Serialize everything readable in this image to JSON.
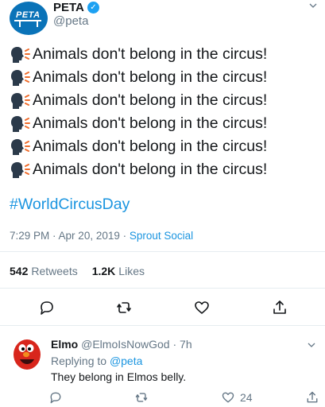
{
  "tweet": {
    "author": {
      "name": "PETA",
      "handle": "@peta",
      "avatar_text": "PETA",
      "verified": true
    },
    "lines": [
      "Animals don't belong in the circus!",
      "Animals don't belong in the circus!",
      "Animals don't belong in the circus!",
      "Animals don't belong in the circus!",
      "Animals don't belong in the circus!",
      "Animals don't belong in the circus!"
    ],
    "hashtag": "#WorldCircusDay",
    "time": "7:29 PM",
    "separator": " · ",
    "date": "Apr 20, 2019",
    "source": "Sprout Social",
    "stats": {
      "retweets_count": "542",
      "retweets_label": "Retweets",
      "likes_count": "1.2K",
      "likes_label": "Likes"
    }
  },
  "reply": {
    "name": "Elmo",
    "handle": "@ElmoIsNowGod",
    "time": "7h",
    "replying_label": "Replying to",
    "replying_handle": "@peta",
    "text": "They belong in Elmos belly.",
    "like_count": "24"
  },
  "colors": {
    "link": "#1b95e0",
    "muted": "#657786",
    "text": "#14171a",
    "divider": "#e6ecf0",
    "speaker_emoji": "#2b3a4a"
  },
  "icons": [
    "chevron-down-icon",
    "verified-badge-icon",
    "speaking-head-icon",
    "reply-icon",
    "retweet-icon",
    "like-icon",
    "share-icon"
  ]
}
